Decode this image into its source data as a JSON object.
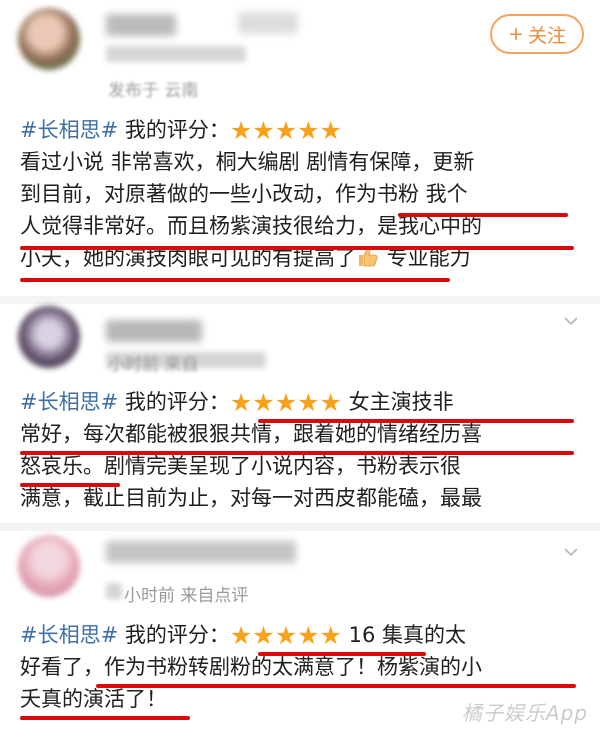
{
  "follow_button": {
    "label": "关注",
    "icon": "plus-icon"
  },
  "posts": [
    {
      "meta": "发布于 云南",
      "lines": [
        {
          "tag": "#长相思#",
          "label": " 我的评分：",
          "stars": "★★★★★",
          "text": ""
        },
        {
          "text": "看过小说 非常喜欢，桐大编剧 剧情有保障，更新"
        },
        {
          "text": "到目前，对原著做的一些小改动，作为书粉 我个"
        },
        {
          "text": "人觉得非常好。而且杨紫演技很给力，是我心中的"
        },
        {
          "text": "小夭，她的演技肉眼可见的有提高了",
          "emoji": "thumbs-up-icon",
          "tail": " 专业能力"
        }
      ]
    },
    {
      "meta": "小时前 来自",
      "lines": [
        {
          "tag": "#长相思#",
          "label": " 我的评分：",
          "stars": "★★★★★",
          "text": " 女主演技非"
        },
        {
          "text": "常好，每次都能被狠狠共情，跟着她的情绪经历喜"
        },
        {
          "text": "怒哀乐。剧情完美呈现了小说内容，书粉表示很"
        },
        {
          "text": "满意，截止目前为止，对每一对西皮都能磕，最最"
        }
      ]
    },
    {
      "meta": "小时前  来自点评",
      "lines": [
        {
          "tag": "#长相思#",
          "label": " 我的评分：",
          "stars": "★★★★★",
          "text": " 16 集真的太"
        },
        {
          "text": "好看了，作为书粉转剧粉的太满意了！杨紫演的小"
        },
        {
          "text": "夭真的演活了！"
        }
      ]
    }
  ],
  "watermark": "橘子娱乐App"
}
